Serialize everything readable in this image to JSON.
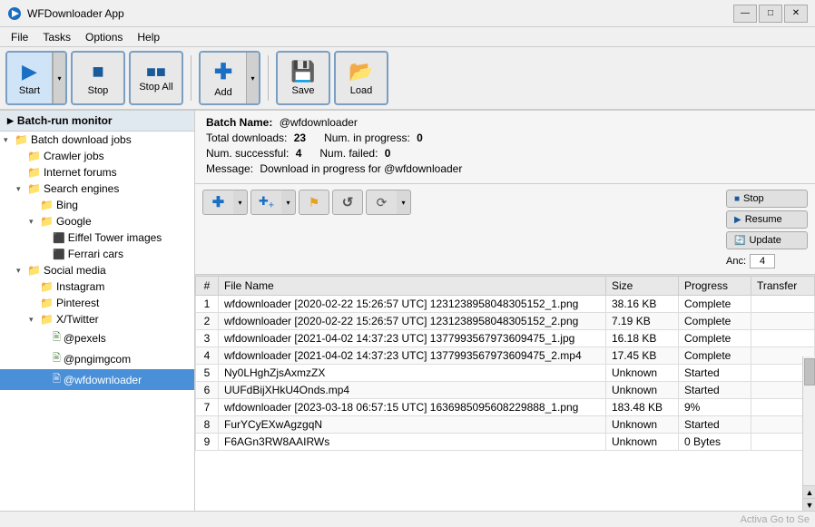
{
  "window": {
    "title": "WFDownloader App",
    "controls": {
      "minimize": "—",
      "maximize": "□",
      "close": "✕"
    }
  },
  "menu": {
    "items": [
      "File",
      "Tasks",
      "Options",
      "Help"
    ]
  },
  "toolbar": {
    "buttons": [
      {
        "id": "start",
        "label": "Start",
        "icon": "▶",
        "active": true
      },
      {
        "id": "stop",
        "label": "Stop",
        "icon": "■"
      },
      {
        "id": "stop-all",
        "label": "Stop All",
        "icon": "■■"
      },
      {
        "id": "add",
        "label": "Add",
        "icon": "✚",
        "has_dropdown": true
      },
      {
        "id": "save",
        "label": "Save",
        "icon": "💾"
      },
      {
        "id": "load",
        "label": "Load",
        "icon": "📂"
      }
    ]
  },
  "sidebar": {
    "header": "Batch-run monitor",
    "tree": [
      {
        "id": "batch-jobs",
        "label": "Batch download jobs",
        "level": 0,
        "expanded": true,
        "type": "folder"
      },
      {
        "id": "crawler-jobs",
        "label": "Crawler jobs",
        "level": 1,
        "type": "folder"
      },
      {
        "id": "internet-forums",
        "label": "Internet forums",
        "level": 1,
        "type": "folder"
      },
      {
        "id": "search-engines",
        "label": "Search engines",
        "level": 1,
        "expanded": true,
        "type": "folder"
      },
      {
        "id": "bing",
        "label": "Bing",
        "level": 2,
        "type": "folder-small"
      },
      {
        "id": "google",
        "label": "Google",
        "level": 2,
        "expanded": true,
        "type": "folder"
      },
      {
        "id": "eiffel-tower",
        "label": "Eiffel Tower images",
        "level": 3,
        "type": "file"
      },
      {
        "id": "ferrari-cars",
        "label": "Ferrari cars",
        "level": 3,
        "type": "file"
      },
      {
        "id": "social-media",
        "label": "Social media",
        "level": 1,
        "expanded": true,
        "type": "folder"
      },
      {
        "id": "instagram",
        "label": "Instagram",
        "level": 2,
        "type": "folder"
      },
      {
        "id": "pinterest",
        "label": "Pinterest",
        "level": 2,
        "type": "folder"
      },
      {
        "id": "x-twitter",
        "label": "X/Twitter",
        "level": 2,
        "expanded": true,
        "type": "folder"
      },
      {
        "id": "pexels",
        "label": "@pexels",
        "level": 3,
        "type": "file"
      },
      {
        "id": "pngimgcom",
        "label": "@pngimgcom",
        "level": 3,
        "type": "file"
      },
      {
        "id": "wfdownloader",
        "label": "@wfdownloader",
        "level": 3,
        "type": "file",
        "selected": true
      }
    ]
  },
  "batch_info": {
    "name_label": "Batch Name:",
    "name_value": "@wfdownloader",
    "total_label": "Total downloads:",
    "total_value": "23",
    "in_progress_label": "Num. in progress:",
    "in_progress_value": "0",
    "successful_label": "Num. successful:",
    "successful_value": "4",
    "failed_label": "Num. failed:",
    "failed_value": "0",
    "message_label": "Message:",
    "message_value": "Download in progress for @wfdownloader"
  },
  "action_buttons": [
    {
      "id": "add-url",
      "icon": "✚",
      "tooltip": "Add URL"
    },
    {
      "id": "add-batch",
      "icon": "✚✚",
      "tooltip": "Add batch"
    },
    {
      "id": "flag",
      "icon": "⚑",
      "tooltip": "Flag"
    },
    {
      "id": "refresh",
      "icon": "↺",
      "tooltip": "Refresh"
    },
    {
      "id": "rotate",
      "icon": "⟳",
      "tooltip": "Rotate",
      "has_dropdown": true
    }
  ],
  "right_buttons": [
    {
      "id": "stop-btn",
      "label": "Stop",
      "icon": "■",
      "color": "#1a5a9a"
    },
    {
      "id": "resume-btn",
      "label": "Resume",
      "icon": "▶",
      "color": "#1a5a9a"
    },
    {
      "id": "update-btn",
      "label": "Update",
      "icon": "🔄",
      "color": "#1a5a9a"
    }
  ],
  "anc": {
    "label": "Anc:",
    "value": "4"
  },
  "table": {
    "columns": [
      "#",
      "File Name",
      "Size",
      "Progress",
      "Transfer"
    ],
    "rows": [
      {
        "num": 1,
        "name": "wfdownloader [2020-02-22 15:26:57 UTC] 1231238958048305152_1.png",
        "size": "38.16 KB",
        "progress": "Complete",
        "transfer": ""
      },
      {
        "num": 2,
        "name": "wfdownloader [2020-02-22 15:26:57 UTC] 1231238958048305152_2.png",
        "size": "7.19 KB",
        "progress": "Complete",
        "transfer": ""
      },
      {
        "num": 3,
        "name": "wfdownloader [2021-04-02 14:37:23 UTC] 1377993567973609475_1.jpg",
        "size": "16.18 KB",
        "progress": "Complete",
        "transfer": ""
      },
      {
        "num": 4,
        "name": "wfdownloader [2021-04-02 14:37:23 UTC] 1377993567973609475_2.mp4",
        "size": "17.45 KB",
        "progress": "Complete",
        "transfer": ""
      },
      {
        "num": 5,
        "name": "Ny0LHghZjsAxmzZX",
        "size": "Unknown",
        "progress": "Started",
        "transfer": ""
      },
      {
        "num": 6,
        "name": "UUFdBijXHkU4Onds.mp4",
        "size": "Unknown",
        "progress": "Started",
        "transfer": ""
      },
      {
        "num": 7,
        "name": "wfdownloader [2023-03-18 06:57:15 UTC] 1636985095608229888_1.png",
        "size": "183.48 KB",
        "progress": "9%",
        "transfer": ""
      },
      {
        "num": 8,
        "name": "FurYCyEXwAgzgqN",
        "size": "Unknown",
        "progress": "Started",
        "transfer": ""
      },
      {
        "num": 9,
        "name": "F6AGn3RW8AAIRWs",
        "size": "Unknown",
        "progress": "0 Bytes",
        "transfer": ""
      }
    ]
  },
  "status_bar": {
    "text": "Activa Go to Se"
  }
}
